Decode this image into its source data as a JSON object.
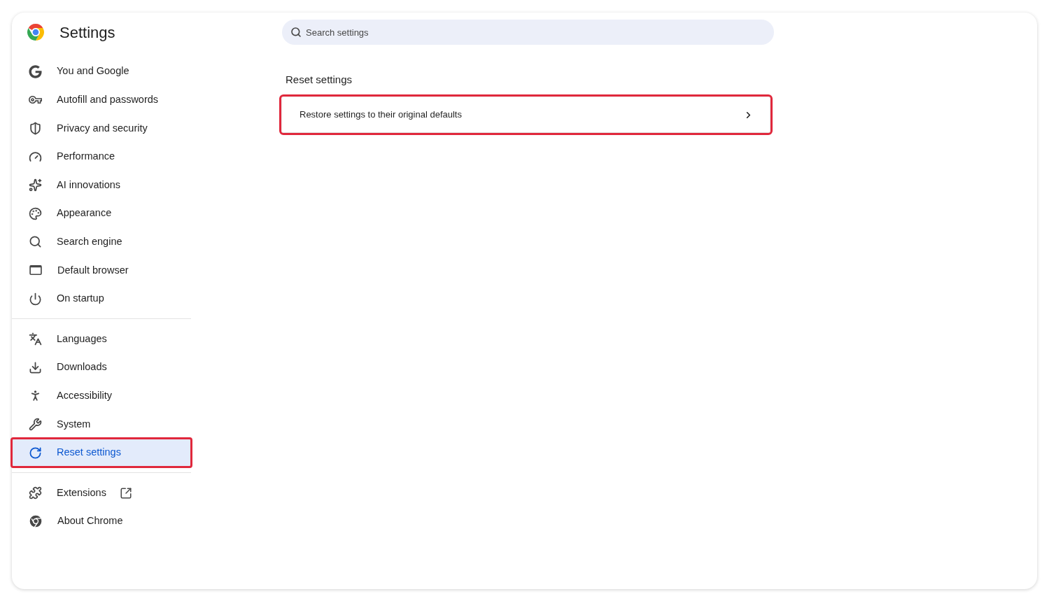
{
  "header": {
    "title": "Settings"
  },
  "search": {
    "placeholder": "Search settings"
  },
  "sidebar": {
    "groups": [
      {
        "items": [
          {
            "label": "You and Google",
            "selected": false,
            "highlighted": false,
            "external_link": false
          },
          {
            "label": "Autofill and passwords",
            "selected": false,
            "highlighted": false,
            "external_link": false
          },
          {
            "label": "Privacy and security",
            "selected": false,
            "highlighted": false,
            "external_link": false
          },
          {
            "label": "Performance",
            "selected": false,
            "highlighted": false,
            "external_link": false
          },
          {
            "label": "AI innovations",
            "selected": false,
            "highlighted": false,
            "external_link": false
          },
          {
            "label": "Appearance",
            "selected": false,
            "highlighted": false,
            "external_link": false
          },
          {
            "label": "Search engine",
            "selected": false,
            "highlighted": false,
            "external_link": false
          },
          {
            "label": "Default browser",
            "selected": false,
            "highlighted": false,
            "external_link": false
          },
          {
            "label": "On startup",
            "selected": false,
            "highlighted": false,
            "external_link": false
          }
        ]
      },
      {
        "items": [
          {
            "label": "Languages",
            "selected": false,
            "highlighted": false,
            "external_link": false
          },
          {
            "label": "Downloads",
            "selected": false,
            "highlighted": false,
            "external_link": false
          },
          {
            "label": "Accessibility",
            "selected": false,
            "highlighted": false,
            "external_link": false
          },
          {
            "label": "System",
            "selected": false,
            "highlighted": false,
            "external_link": false
          },
          {
            "label": "Reset settings",
            "selected": true,
            "highlighted": true,
            "external_link": false
          }
        ]
      },
      {
        "items": [
          {
            "label": "Extensions",
            "selected": false,
            "highlighted": false,
            "external_link": true
          },
          {
            "label": "About Chrome",
            "selected": false,
            "highlighted": false,
            "external_link": false
          }
        ]
      }
    ]
  },
  "section": {
    "title": "Reset settings",
    "rows": [
      {
        "label": "Restore settings to their original defaults",
        "highlighted": true
      }
    ]
  }
}
